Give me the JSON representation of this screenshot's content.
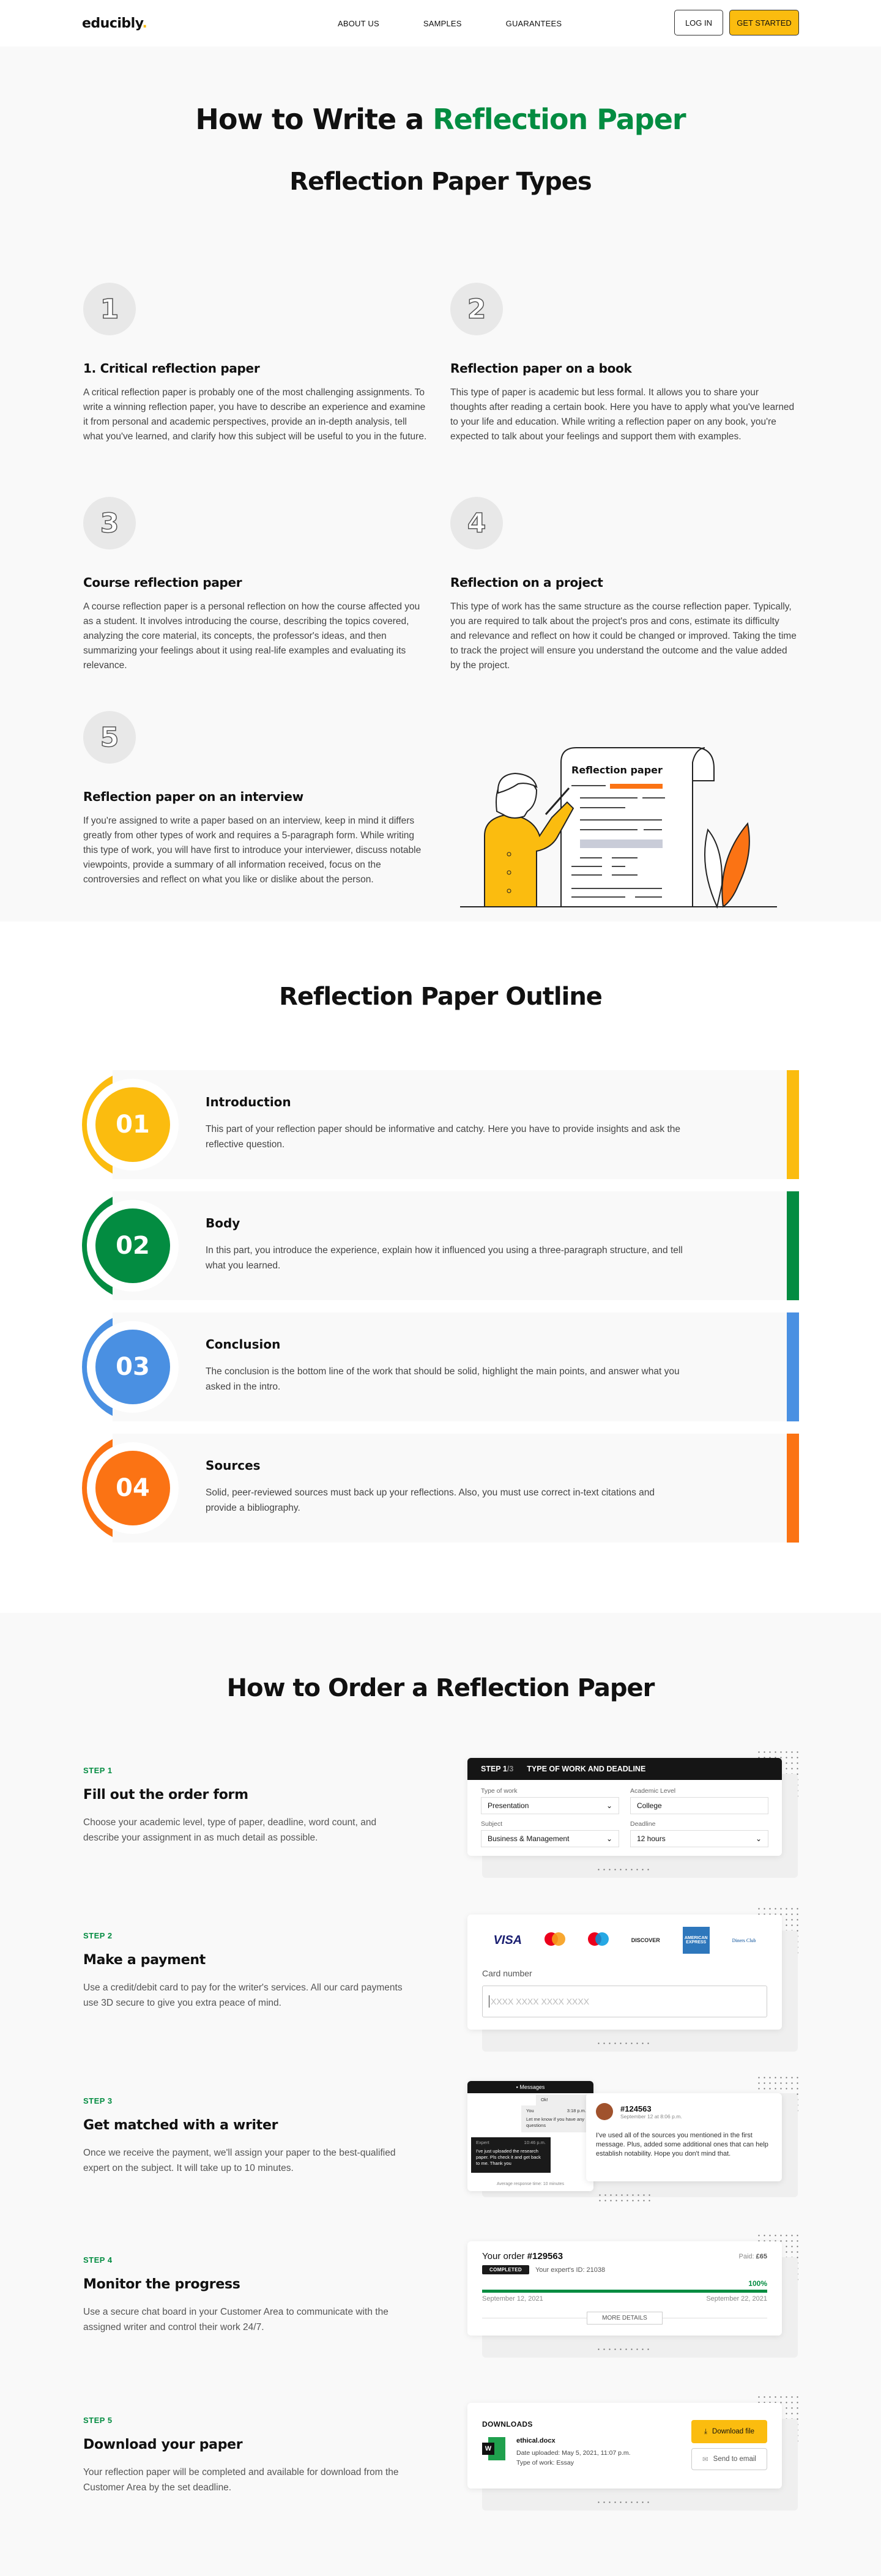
{
  "header": {
    "logo": "educibly",
    "nav": [
      "ABOUT US",
      "SAMPLES",
      "GUARANTEES"
    ],
    "login_label": "LOG IN",
    "get_started_label": "GET STARTED"
  },
  "hero": {
    "title_prefix": "How to Write a ",
    "title_highlight": "Reflection Paper",
    "types_title": "Reflection Paper Types"
  },
  "types": [
    {
      "num": "1",
      "title": "1. Critical reflection paper",
      "text": "A critical reflection paper is probably one of the most challenging assignments. To write a winning reflection paper, you have to describe an experience and examine it from personal and academic perspectives, provide an in-depth analysis, tell what you've learned, and clarify how this subject will be useful to you in the future."
    },
    {
      "num": "2",
      "title": "Reflection paper on a book",
      "text": "This type of paper is academic but less formal. It allows you to share your thoughts after reading a certain book. Here you have to apply what you've learned to your life and education. While writing a reflection paper on any book, you're expected to talk about your feelings and support them with examples."
    },
    {
      "num": "3",
      "title": "Course reflection paper",
      "text": "A course reflection paper is a personal reflection on how the course affected you as a student. It involves introducing the course, describing the topics covered, analyzing the core material, its concepts, the professor's ideas, and then summarizing your feelings about it using real-life examples and evaluating its relevance."
    },
    {
      "num": "4",
      "title": "Reflection on a project",
      "text": "This type of work has the same structure as the course reflection paper. Typically, you are required to talk about the project's pros and cons, estimate its difficulty and relevance and reflect on how it could be changed or improved. Taking the time to track the project will ensure you understand the outcome and the value added by the project."
    },
    {
      "num": "5",
      "title": "Reflection paper on an interview",
      "text": "If you're assigned to write a paper based on an interview, keep in mind it differs greatly from other types of work and requires a 5-paragraph form. While writing this type of work, you will have first to introduce your interviewer, discuss notable viewpoints, provide a summary of all information received, focus on the controversies and reflect on what you like or dislike about the person."
    }
  ],
  "illustration": {
    "paper_title": "Reflection paper"
  },
  "outline": {
    "title": "Reflection Paper Outline",
    "items": [
      {
        "num": "01",
        "title": "Introduction",
        "text": "This part of your reflection paper should be informative and catchy. Here you have to provide insights and ask the reflective question.",
        "color": "#fbbc0f"
      },
      {
        "num": "02",
        "title": "Body",
        "text": "In this part, you introduce the experience, explain how it influenced you using a three-paragraph structure, and tell what you learned.",
        "color": "#038c41"
      },
      {
        "num": "03",
        "title": "Conclusion",
        "text": "The conclusion is the bottom line of the work that should be solid, highlight the main points, and answer what you asked in the intro.",
        "color": "#4a90e2"
      },
      {
        "num": "04",
        "title": "Sources",
        "text": "Solid, peer-reviewed sources must back up your reflections. Also, you must use correct in-text citations and provide a bibliography.",
        "color": "#fb7314"
      }
    ]
  },
  "order": {
    "title": "How to Order a Reflection Paper",
    "steps": [
      {
        "label": "STEP 1",
        "title": "Fill out the order form",
        "text": "Choose your academic level, type of paper, deadline, word count, and describe your assignment in as much detail as possible."
      },
      {
        "label": "STEP 2",
        "title": "Make a payment",
        "text": "Use a credit/debit card to pay for the writer's services. All our card payments use 3D secure to give you extra peace of mind."
      },
      {
        "label": "STEP 3",
        "title": "Get matched with a writer",
        "text": "Once we receive the payment, we'll assign your paper to the best-qualified expert on the subject. It will take up to 10 minutes."
      },
      {
        "label": "STEP 4",
        "title": "Monitor the progress",
        "text": "Use a secure chat board in your Customer Area to communicate with the assigned writer and control their work 24/7."
      },
      {
        "label": "STEP 5",
        "title": "Download your paper",
        "text": "Your reflection paper will be completed and available for download from the Customer Area by the set deadline."
      }
    ],
    "form": {
      "step": "STEP 1",
      "step_total": "/3",
      "heading": "TYPE OF WORK AND DEADLINE",
      "fields": [
        {
          "label": "Type of work",
          "value": "Presentation",
          "dropdown": true
        },
        {
          "label": "Academic Level",
          "value": "College",
          "dropdown": false
        },
        {
          "label": "Subject",
          "value": "Business & Management",
          "dropdown": true
        },
        {
          "label": "Deadline",
          "value": "12 hours",
          "dropdown": true
        }
      ]
    },
    "payment": {
      "cards": [
        "VISA",
        "mastercard",
        "maestro",
        "DISCOVER",
        "AMERICAN EXPRESS",
        "Diners Club"
      ],
      "card_label": "Card number",
      "card_placeholder": "XXXX XXXX XXXX XXXX"
    },
    "chat": {
      "title": "Messages",
      "ok": "Ok!",
      "you_name": "You",
      "you_time": "3:18 p.m.",
      "you_text": "Let me know if you have any questions",
      "expert_name": "Expert",
      "expert_time": "10:46 p.m.",
      "expert_text": "I've just uploaded the research paper. Pls check it and get back to me. Thank you",
      "avg": "Average response time: 10 minutes",
      "review_id": "#124563",
      "review_date": "September 12 at 8:06 p.m.",
      "review_text": "I've used all of the sources you mentioned in the first message. Plus, added some additional ones that can help establish notability. Hope you don't mind that."
    },
    "progress": {
      "order_prefix": "Your order ",
      "order_no": "#129563",
      "paid_label": "Paid: ",
      "paid_value": "£65",
      "status": "COMPLETED",
      "expert_id": "Your expert's ID: 21038",
      "percent_label": "100%",
      "percent": 100,
      "start_date": "September 12, 2021",
      "end_date": "September 22, 2021",
      "more_label": "MORE DETAILS"
    },
    "download": {
      "title": "DOWNLOADS",
      "file_name": "ethical.docx",
      "uploaded": "Date uploaded: May 5, 2021, 11:07 p.m.",
      "type": "Type of work: Essay",
      "download_label": "Download file",
      "email_label": "Send to email"
    }
  }
}
